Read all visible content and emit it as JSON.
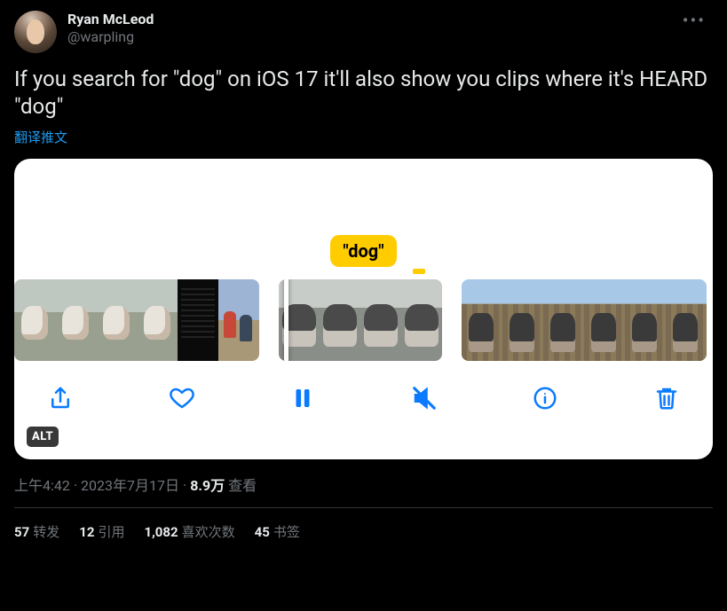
{
  "user": {
    "display_name": "Ryan McLeod",
    "handle": "@warpling"
  },
  "tweet": {
    "text": "If you search for \"dog\" on iOS 17 it'll also show you clips where it's HEARD \"dog\"",
    "translate_label": "翻译推文"
  },
  "media": {
    "search_token": "\"dog\"",
    "alt_badge": "ALT"
  },
  "meta": {
    "time": "上午4:42",
    "date": "2023年7月17日",
    "views_num": "8.9万",
    "views_label": "查看"
  },
  "stats": {
    "retweets_num": "57",
    "retweets_label": "转发",
    "quotes_num": "12",
    "quotes_label": "引用",
    "likes_num": "1,082",
    "likes_label": "喜欢次数",
    "bookmarks_num": "45",
    "bookmarks_label": "书签"
  }
}
